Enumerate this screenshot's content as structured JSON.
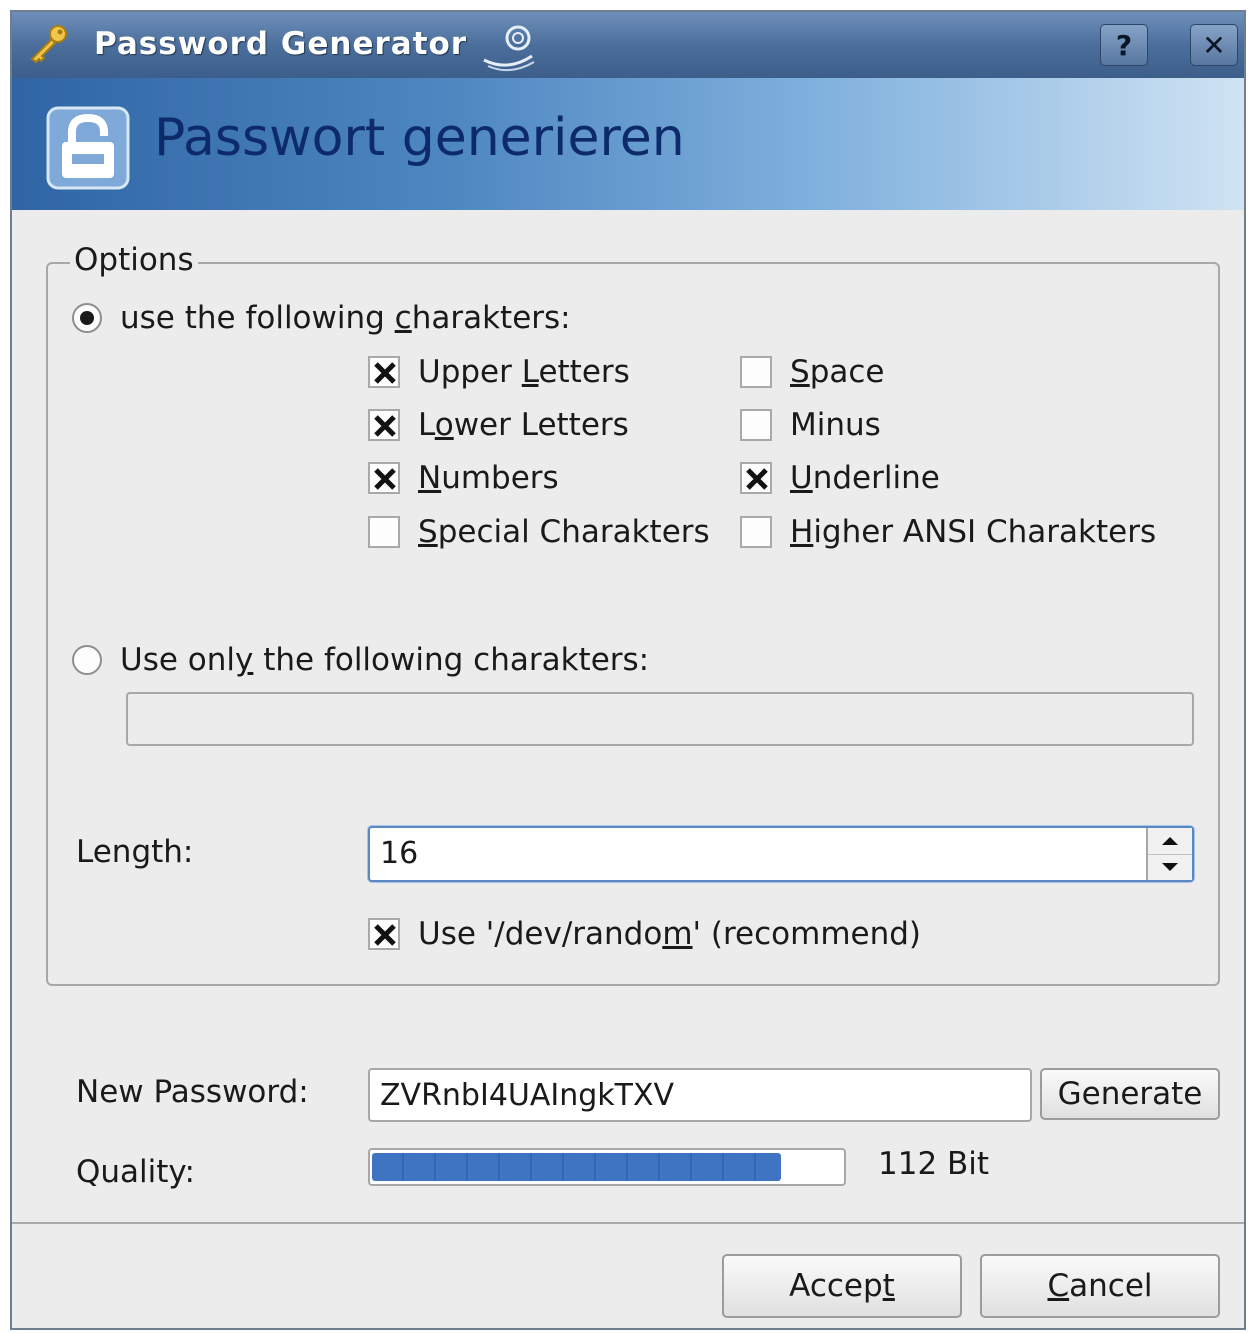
{
  "window": {
    "title": "Password Generator",
    "help_label": "?",
    "close_label": "✕"
  },
  "banner": {
    "heading": "Passwort generieren"
  },
  "options": {
    "group_title": "Options",
    "radio_following": {
      "pre": "use the following ",
      "mnemonic": "c",
      "post": "harakters:",
      "selected": true
    },
    "checkboxes": [
      {
        "pre": "Upper ",
        "mnemonic": "L",
        "post": "etters",
        "checked": true
      },
      {
        "pre": "L",
        "mnemonic": "o",
        "post": "wer Letters",
        "checked": true
      },
      {
        "pre": "",
        "mnemonic": "N",
        "post": "umbers",
        "checked": true
      },
      {
        "pre": "",
        "mnemonic": "S",
        "post": "pecial Charakters",
        "checked": false
      },
      {
        "pre": "",
        "mnemonic": "S",
        "post": "pace",
        "checked": false
      },
      {
        "pre": "Minus",
        "mnemonic": "",
        "post": "",
        "checked": false
      },
      {
        "pre": "",
        "mnemonic": "U",
        "post": "nderline",
        "checked": true
      },
      {
        "pre": "",
        "mnemonic": "H",
        "post": "igher ANSI Charakters",
        "checked": false
      }
    ],
    "radio_only": {
      "pre": "Use onl",
      "mnemonic": "y",
      "post": " the following charakters:",
      "selected": false
    },
    "only_chars_value": "",
    "length_label": "Length:",
    "length_value": "16",
    "devrandom": {
      "pre": "Use '/dev/rando",
      "mnemonic": "m",
      "post": "' (recommend)",
      "checked": true
    }
  },
  "password": {
    "label": "New Password:",
    "value": "ZVRnbI4UAIngkTXV",
    "generate_label": "Generate"
  },
  "quality": {
    "label": "Quality:",
    "text": "112 Bit",
    "fraction": 0.87
  },
  "buttons": {
    "accept_pre": "Accep",
    "accept_mnemonic": "t",
    "cancel_mnemonic": "C",
    "cancel_post": "ancel"
  },
  "colors": {
    "title_bar": "#4b6e9c",
    "banner_start": "#2f65a4",
    "heading": "#0d2a6b",
    "progress": "#3f74c2"
  }
}
